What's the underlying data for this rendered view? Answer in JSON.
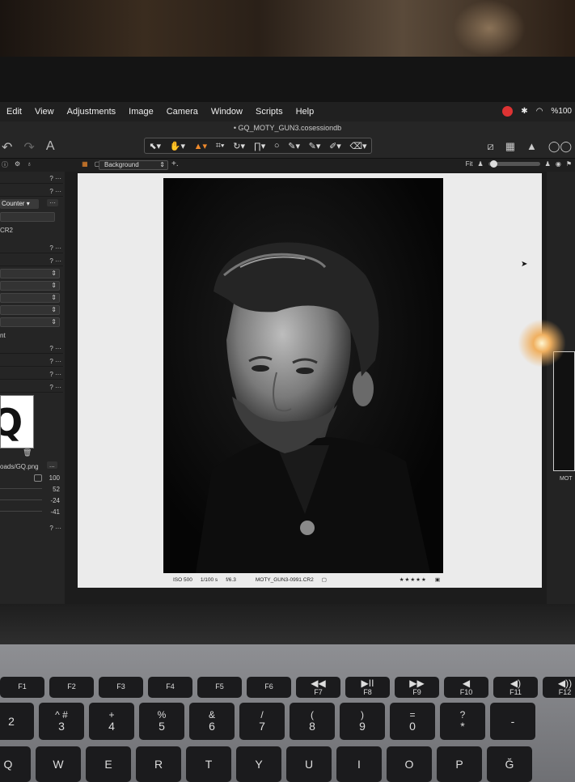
{
  "menubar": {
    "items": [
      "Edit",
      "View",
      "Adjustments",
      "Image",
      "Camera",
      "Window",
      "Scripts",
      "Help"
    ],
    "battery": "%100"
  },
  "window": {
    "title": "GQ_MOTY_GUN3.cosessiondb"
  },
  "toolbar": {
    "text_tool": "A"
  },
  "viewer": {
    "background_select": "Background",
    "fit_label": "Fit"
  },
  "left_panel": {
    "counter_label": "Counter",
    "file_ext": "CR2",
    "nt_text": "nt",
    "question": "?",
    "more": "···",
    "overlay_path": "oads/GQ.png",
    "more_button": "...",
    "values": [
      "100",
      "52",
      "-24",
      "-41"
    ],
    "logo_text": "Q"
  },
  "photo": {
    "iso": "ISO 500",
    "shutter": "1/100 s",
    "aperture": "f/6.3",
    "filename": "MOTY_GUN3-0991.CR2",
    "stars": "★★★★★"
  },
  "right_panel": {
    "label": "MOT"
  },
  "keyboard": {
    "row1": [
      {
        "top": "",
        "bottom": "F1"
      },
      {
        "top": "",
        "bottom": "F2"
      },
      {
        "top": "",
        "bottom": "F3"
      },
      {
        "top": "",
        "bottom": "F4"
      },
      {
        "top": "",
        "bottom": "F5"
      },
      {
        "top": "",
        "bottom": "F6"
      },
      {
        "top": "◀◀",
        "bottom": "F7"
      },
      {
        "top": "▶II",
        "bottom": "F8"
      },
      {
        "top": "▶▶",
        "bottom": "F9"
      },
      {
        "top": "◀",
        "bottom": "F10"
      },
      {
        "top": "◀)",
        "bottom": "F11"
      },
      {
        "top": "◀))",
        "bottom": "F12"
      }
    ],
    "row2": [
      {
        "top": "",
        "bottom": "2"
      },
      {
        "top": "^ #",
        "bottom": "3"
      },
      {
        "top": "+",
        "bottom": "4"
      },
      {
        "top": "%",
        "bottom": "5"
      },
      {
        "top": "&",
        "bottom": "6"
      },
      {
        "top": "/",
        "bottom": "7"
      },
      {
        "top": "(",
        "bottom": "8"
      },
      {
        "top": ")",
        "bottom": "9"
      },
      {
        "top": "=",
        "bottom": "0"
      },
      {
        "top": "?",
        "bottom": "*"
      },
      {
        "top": "",
        "bottom": "-"
      }
    ],
    "row3": [
      "Q",
      "W",
      "E",
      "R",
      "T",
      "Y",
      "U",
      "I",
      "O",
      "P",
      "Ğ"
    ]
  }
}
